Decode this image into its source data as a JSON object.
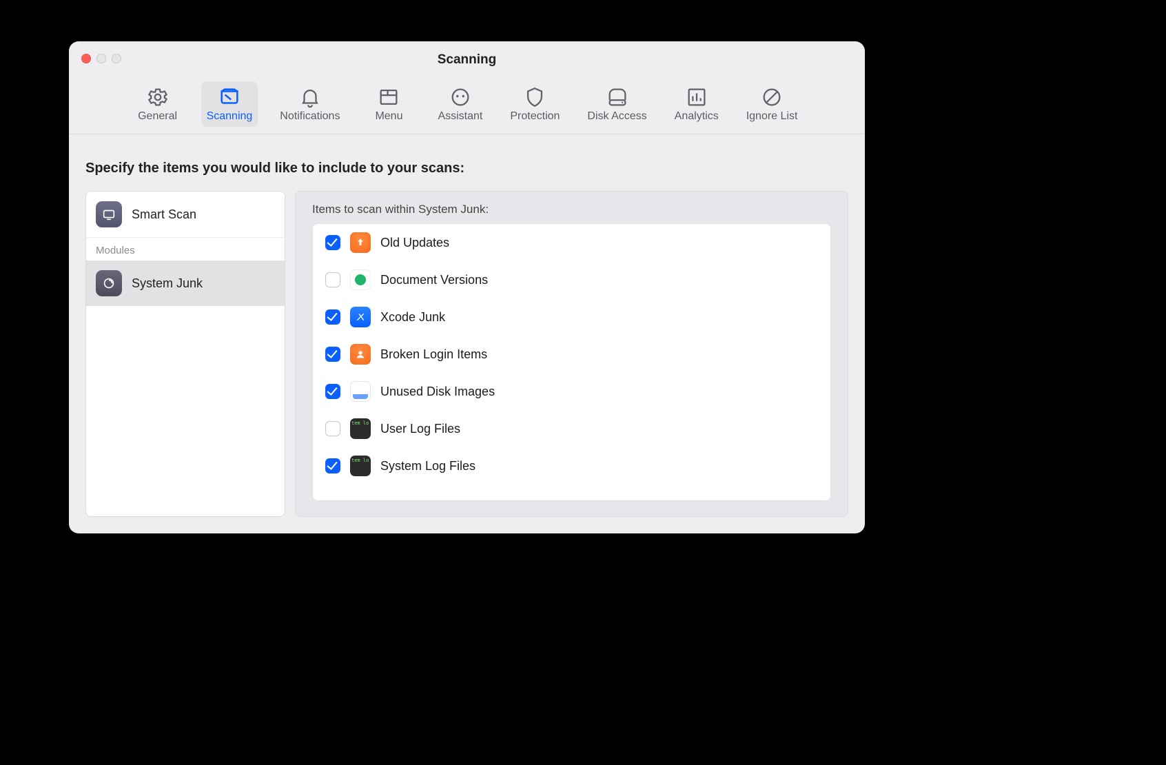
{
  "window": {
    "title": "Scanning"
  },
  "toolbar": {
    "general": "General",
    "scanning": "Scanning",
    "notifications": "Notifications",
    "menu": "Menu",
    "assistant": "Assistant",
    "protection": "Protection",
    "diskaccess": "Disk Access",
    "analytics": "Analytics",
    "ignorelist": "Ignore List",
    "selected": "scanning"
  },
  "body": {
    "heading": "Specify the items you would like to include to your scans:"
  },
  "sidebar": {
    "smartscan": "Smart Scan",
    "modules_header": "Modules",
    "systemjunk": "System Junk",
    "selected": "systemjunk"
  },
  "panel": {
    "heading": "Items to scan within System Junk:",
    "items": [
      {
        "key": "oldupdates",
        "label": "Old Updates",
        "checked": true,
        "icon": "oldupd"
      },
      {
        "key": "docversions",
        "label": "Document Versions",
        "checked": false,
        "icon": "docv"
      },
      {
        "key": "xcodejunk",
        "label": "Xcode Junk",
        "checked": true,
        "icon": "xcode"
      },
      {
        "key": "brokenlogin",
        "label": "Broken Login Items",
        "checked": true,
        "icon": "login"
      },
      {
        "key": "unuseddisk",
        "label": "Unused Disk Images",
        "checked": true,
        "icon": "disk"
      },
      {
        "key": "userlogs",
        "label": "User Log Files",
        "checked": false,
        "icon": "log"
      },
      {
        "key": "systemlogs",
        "label": "System Log Files",
        "checked": true,
        "icon": "log"
      }
    ]
  }
}
